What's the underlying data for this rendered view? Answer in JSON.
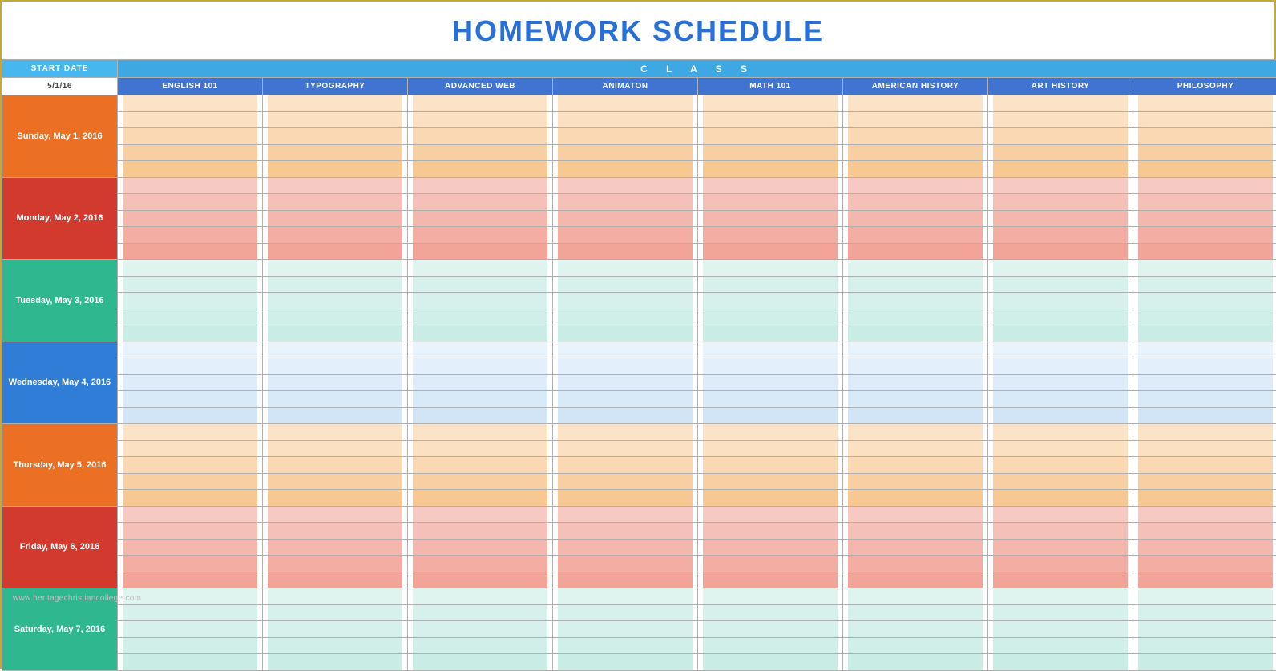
{
  "title": "HOMEWORK SCHEDULE",
  "header": {
    "start_date_label": "START DATE",
    "class_label": "C L A S S",
    "start_date_value": "5/1/16",
    "columns": [
      "ENGLISH 101",
      "TYPOGRAPHY",
      "ADVANCED WEB",
      "ANIMATON",
      "MATH 101",
      "AMERICAN HISTORY",
      "ART HISTORY",
      "PHILOSOPHY"
    ]
  },
  "days": [
    {
      "label": "Sunday, May 1, 2016",
      "rows": [
        "",
        "",
        "",
        "",
        ""
      ]
    },
    {
      "label": "Monday, May 2, 2016",
      "rows": [
        "",
        "",
        "",
        "",
        ""
      ]
    },
    {
      "label": "Tuesday, May 3, 2016",
      "rows": [
        "",
        "",
        "",
        "",
        ""
      ]
    },
    {
      "label": "Wednesday, May 4, 2016",
      "rows": [
        "",
        "",
        "",
        "",
        ""
      ]
    },
    {
      "label": "Thursday, May 5, 2016",
      "rows": [
        "",
        "",
        "",
        "",
        ""
      ]
    },
    {
      "label": "Friday, May 6, 2016",
      "rows": [
        "",
        "",
        "",
        "",
        ""
      ]
    },
    {
      "label": "Saturday, May 7, 2016",
      "rows": [
        "",
        "",
        "",
        "",
        ""
      ]
    }
  ],
  "watermark": "www.heritagechristiancollege.com"
}
